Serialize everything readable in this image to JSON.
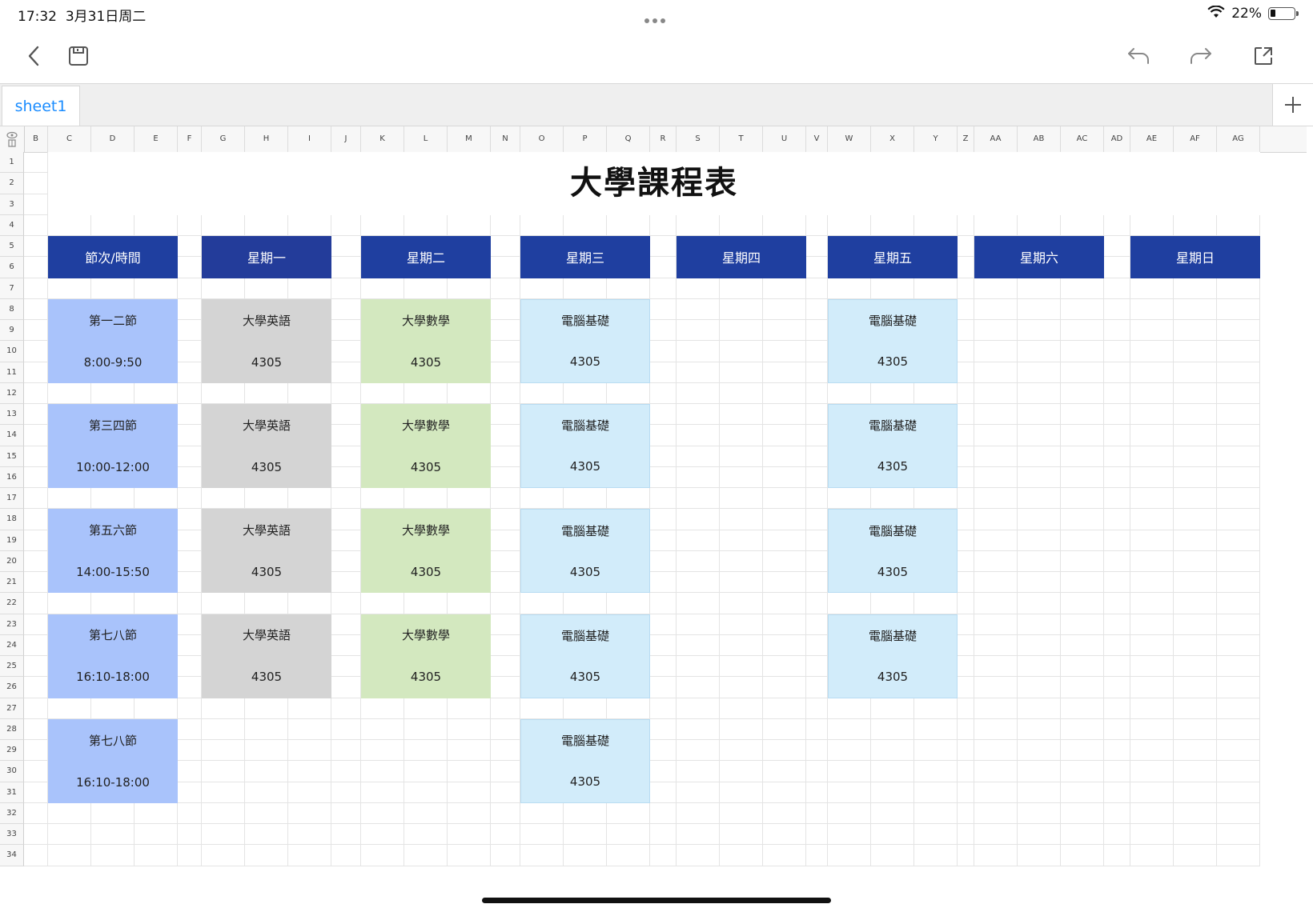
{
  "status_bar": {
    "time": "17:32",
    "date": "3月31日周二",
    "battery_percent": "22%",
    "battery_level": 0.22,
    "wifi_icon": "wifi-icon"
  },
  "toolbar": {
    "back_icon": "chevron-left-icon",
    "save_icon": "save-icon",
    "undo_icon": "undo-icon",
    "redo_icon": "redo-icon",
    "share_icon": "share-icon"
  },
  "sheets": {
    "active": "sheet1",
    "add_icon": "plus-icon"
  },
  "columns": [
    "B",
    "C",
    "D",
    "E",
    "F",
    "G",
    "H",
    "I",
    "J",
    "K",
    "L",
    "M",
    "N",
    "O",
    "P",
    "Q",
    "R",
    "S",
    "T",
    "U",
    "V",
    "W",
    "X",
    "Y",
    "Z",
    "AA",
    "AB",
    "AC",
    "AD",
    "AE",
    "AF",
    "AG"
  ],
  "rows": [
    "1",
    "2",
    "3",
    "4",
    "5",
    "6",
    "7",
    "8",
    "9",
    "10",
    "11",
    "12",
    "13",
    "14",
    "15",
    "16",
    "17",
    "18",
    "19",
    "20",
    "21",
    "22",
    "23",
    "24",
    "25",
    "26",
    "27",
    "28",
    "29",
    "30",
    "31",
    "32",
    "33",
    "34"
  ],
  "schedule": {
    "title": "大學課程表",
    "headers": [
      "節次/時間",
      "星期一",
      "星期二",
      "星期三",
      "星期四",
      "星期五",
      "星期六",
      "星期日"
    ],
    "periods": [
      {
        "name": "第一二節",
        "time": "8:00-9:50"
      },
      {
        "name": "第三四節",
        "time": "10:00-12:00"
      },
      {
        "name": "第五六節",
        "time": "14:00-15:50"
      },
      {
        "name": "第七八節",
        "time": "16:10-18:00"
      },
      {
        "name": "第七八節",
        "time": "16:10-18:00"
      }
    ],
    "courses": {
      "monday": [
        {
          "course": "大學英語",
          "room": "4305"
        },
        {
          "course": "大學英語",
          "room": "4305"
        },
        {
          "course": "大學英語",
          "room": "4305"
        },
        {
          "course": "大學英語",
          "room": "4305"
        }
      ],
      "tuesday": [
        {
          "course": "大學數學",
          "room": "4305"
        },
        {
          "course": "大學數學",
          "room": "4305"
        },
        {
          "course": "大學數學",
          "room": "4305"
        },
        {
          "course": "大學數學",
          "room": "4305"
        }
      ],
      "wednesday": [
        {
          "course": "電腦基礎",
          "room": "4305"
        },
        {
          "course": "電腦基礎",
          "room": "4305"
        },
        {
          "course": "電腦基礎",
          "room": "4305"
        },
        {
          "course": "電腦基礎",
          "room": "4305"
        },
        {
          "course": "電腦基礎",
          "room": "4305"
        }
      ],
      "friday": [
        {
          "course": "電腦基礎",
          "room": "4305"
        },
        {
          "course": "電腦基礎",
          "room": "4305"
        },
        {
          "course": "電腦基礎",
          "room": "4305"
        },
        {
          "course": "電腦基礎",
          "room": "4305"
        }
      ]
    },
    "colors": {
      "header": "#1f3fa0",
      "period": "#a9c3fb",
      "english": "#d4d4d4",
      "math": "#d3e8bf",
      "computer": "#d2ecfa"
    }
  }
}
